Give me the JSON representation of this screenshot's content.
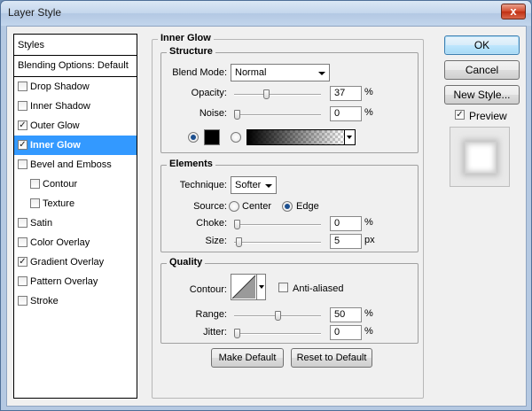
{
  "window": {
    "title": "Layer Style",
    "close_glyph": "x"
  },
  "styles_panel": {
    "header": "Styles",
    "blending_options": "Blending Options: Default",
    "items": [
      {
        "label": "Drop Shadow",
        "checked": false,
        "sub": false,
        "selected": false
      },
      {
        "label": "Inner Shadow",
        "checked": false,
        "sub": false,
        "selected": false
      },
      {
        "label": "Outer Glow",
        "checked": true,
        "sub": false,
        "selected": false
      },
      {
        "label": "Inner Glow",
        "checked": true,
        "sub": false,
        "selected": true
      },
      {
        "label": "Bevel and Emboss",
        "checked": false,
        "sub": false,
        "selected": false
      },
      {
        "label": "Contour",
        "checked": false,
        "sub": true,
        "selected": false
      },
      {
        "label": "Texture",
        "checked": false,
        "sub": true,
        "selected": false
      },
      {
        "label": "Satin",
        "checked": false,
        "sub": false,
        "selected": false
      },
      {
        "label": "Color Overlay",
        "checked": false,
        "sub": false,
        "selected": false
      },
      {
        "label": "Gradient Overlay",
        "checked": true,
        "sub": false,
        "selected": false
      },
      {
        "label": "Pattern Overlay",
        "checked": false,
        "sub": false,
        "selected": false
      },
      {
        "label": "Stroke",
        "checked": false,
        "sub": false,
        "selected": false
      }
    ]
  },
  "inner_glow": {
    "title": "Inner Glow",
    "structure": {
      "title": "Structure",
      "blend_mode_label": "Blend Mode:",
      "blend_mode_value": "Normal",
      "opacity_label": "Opacity:",
      "opacity_value": "37",
      "opacity_unit": "%",
      "noise_label": "Noise:",
      "noise_value": "0",
      "noise_unit": "%",
      "color_mode": "solid",
      "glow_color": "#000000"
    },
    "elements": {
      "title": "Elements",
      "technique_label": "Technique:",
      "technique_value": "Softer",
      "source_label": "Source:",
      "source_center": "Center",
      "source_edge": "Edge",
      "source_selected": "Edge",
      "choke_label": "Choke:",
      "choke_value": "0",
      "choke_unit": "%",
      "size_label": "Size:",
      "size_value": "5",
      "size_unit": "px"
    },
    "quality": {
      "title": "Quality",
      "contour_label": "Contour:",
      "anti_aliased_label": "Anti-aliased",
      "anti_aliased": false,
      "range_label": "Range:",
      "range_value": "50",
      "range_unit": "%",
      "jitter_label": "Jitter:",
      "jitter_value": "0",
      "jitter_unit": "%"
    },
    "make_default": "Make Default",
    "reset_to_default": "Reset to Default"
  },
  "actions": {
    "ok": "OK",
    "cancel": "Cancel",
    "new_style": "New Style...",
    "preview_label": "Preview",
    "preview_checked": true
  }
}
